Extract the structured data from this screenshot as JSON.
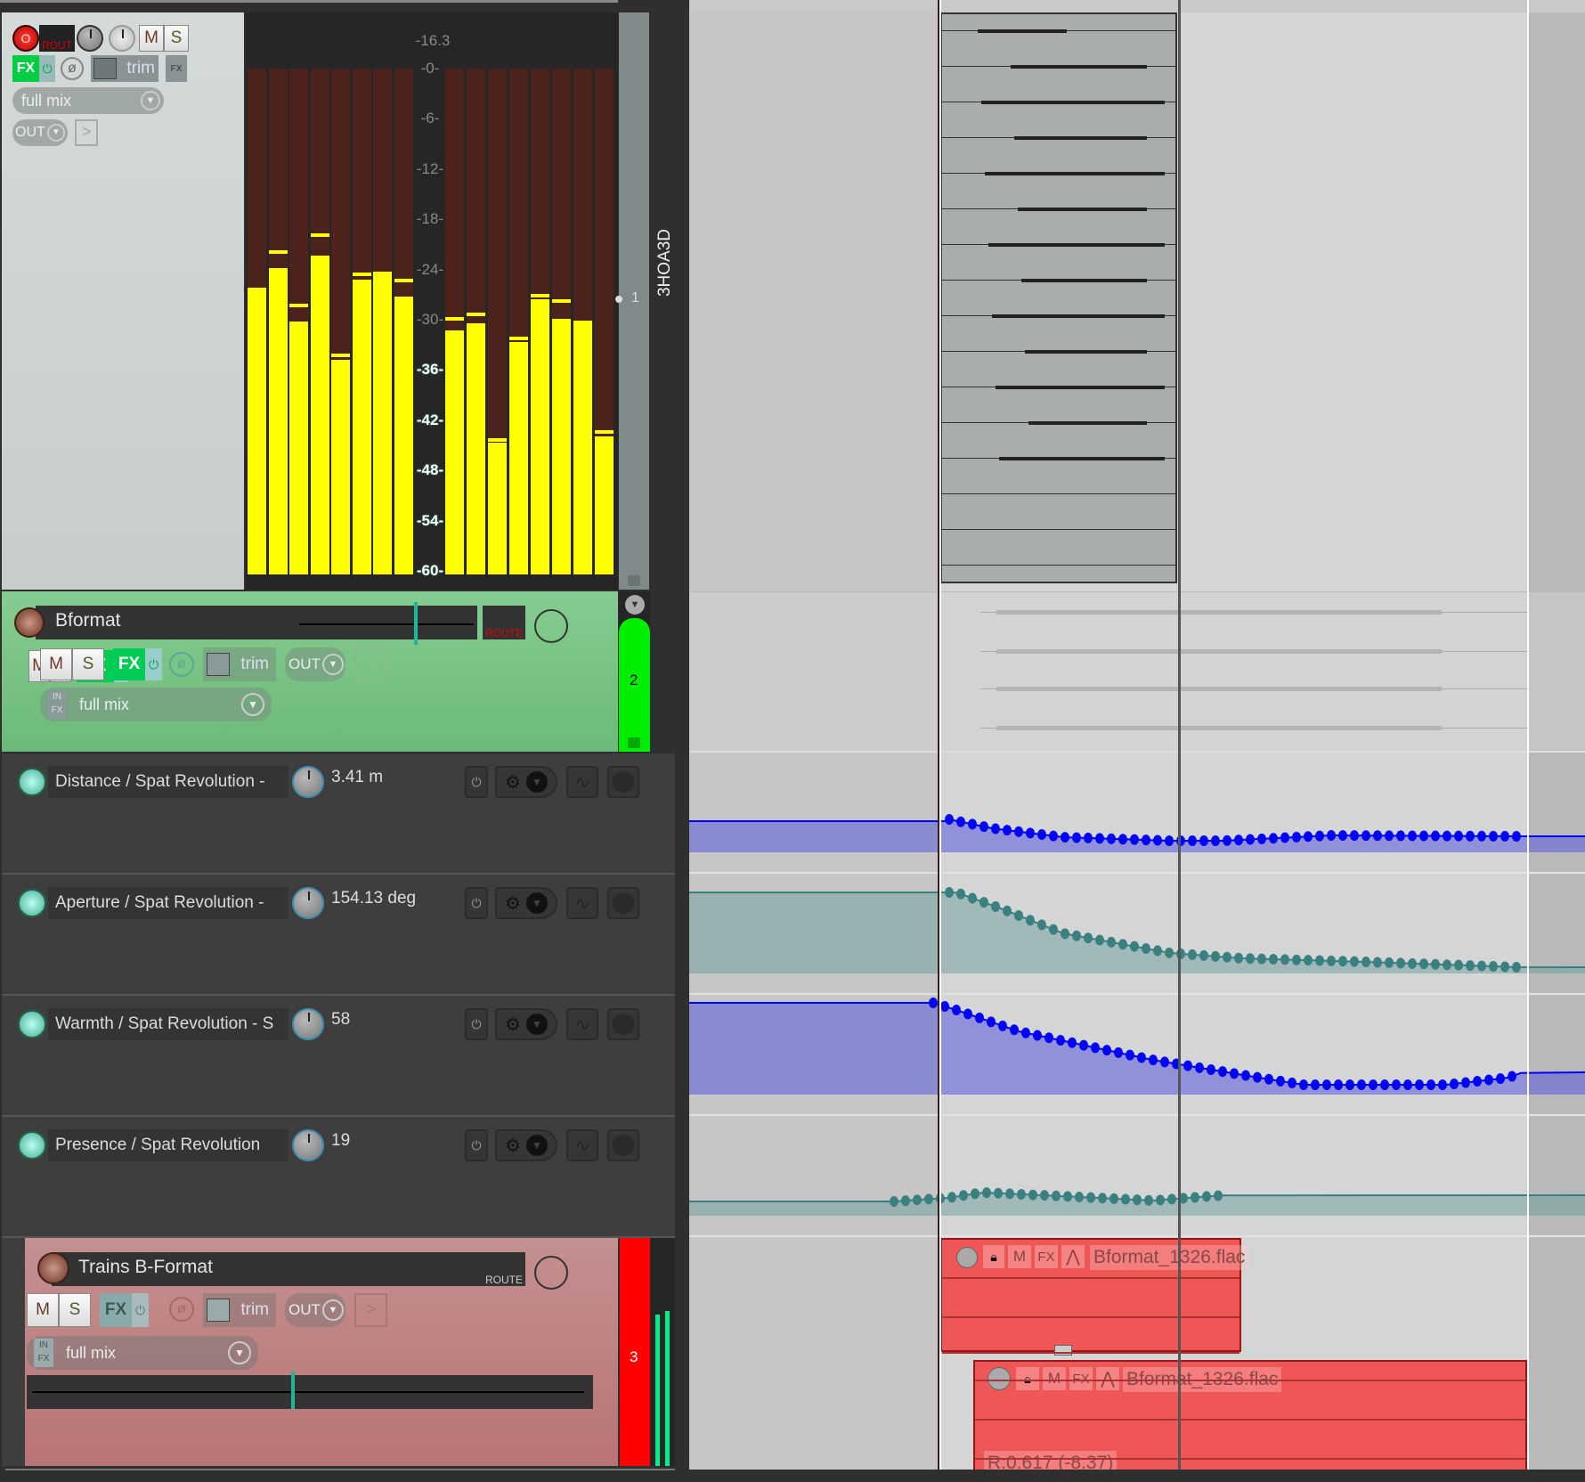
{
  "master": {
    "rec_label": "O",
    "rout_label": "ROUT",
    "mute": "M",
    "solo": "S",
    "fx": "FX",
    "trim": "trim",
    "fxin": "FX",
    "input": "full mix",
    "out": "OUT",
    "peak": "-16.3",
    "track_number": "1",
    "track_name": "3HOA3D",
    "meter_scale": [
      "-0-",
      "-6-",
      "-12-",
      "-18-",
      "-24-",
      "-30-",
      "-36-",
      "-42-",
      "-48-",
      "-54-",
      "-60-"
    ],
    "meter_levels_db": [
      -26.2,
      -23.8,
      -30.2,
      -22.3,
      -34.8,
      -25.2,
      -24.3,
      -27.2,
      -31.3,
      -30.4,
      -44.7,
      -32.7,
      -27.6,
      -29.9,
      -30.1,
      -43.9
    ],
    "meter_peaks_db": [
      null,
      -21.7,
      -28.1,
      -19.7,
      -34.0,
      -24.4,
      null,
      -25.1,
      -29.7,
      -29.1,
      -44.2,
      -32.0,
      -26.9,
      -27.6,
      null,
      -43.2
    ],
    "meter_range_db": [
      -60,
      0
    ]
  },
  "bformat": {
    "name": "Bformat",
    "route": "ROUTE",
    "mute": "M",
    "solo": "S",
    "fx": "FX",
    "trim": "trim",
    "out": "OUT",
    "in_top": "IN",
    "in_bot": "FX",
    "input": "full mix",
    "track_number": "2",
    "color": "#7cc886"
  },
  "envelopes": [
    {
      "name": "Distance / Spat Revolution -",
      "value": "3.41 m",
      "color": "#0000ff"
    },
    {
      "name": "Aperture / Spat Revolution -",
      "value": "154.13 deg",
      "color": "#3a8080"
    },
    {
      "name": "Warmth / Spat Revolution - S",
      "value": "58",
      "color": "#0000ff"
    },
    {
      "name": "Presence / Spat Revolution",
      "value": "19",
      "color": "#3a8080"
    }
  ],
  "trains": {
    "name": "Trains B-Format",
    "route": "ROUTE",
    "mute": "M",
    "solo": "S",
    "fx": "FX",
    "trim": "trim",
    "out": "OUT",
    "in_top": "IN",
    "in_bot": "FX",
    "input": "full mix",
    "track_number": "3",
    "color": "#c48888"
  },
  "items": [
    {
      "name": "Bformat_1326.flac",
      "m": "M",
      "fx": "FX"
    },
    {
      "name": "Bformat_1326.flac",
      "m": "M",
      "fx": "FX",
      "readout": "R:0.617 (-8.37)"
    }
  ]
}
